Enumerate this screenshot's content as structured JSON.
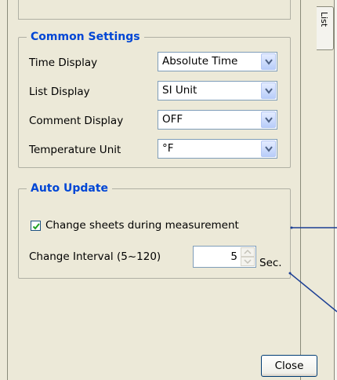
{
  "side_tab": {
    "label": "List"
  },
  "common_settings": {
    "title": "Common Settings",
    "rows": [
      {
        "label": "Time Display",
        "value": "Absolute Time"
      },
      {
        "label": "List Display",
        "value": "SI Unit"
      },
      {
        "label": "Comment Display",
        "value": "OFF"
      },
      {
        "label": "Temperature Unit",
        "value": "°F"
      }
    ]
  },
  "auto_update": {
    "title": "Auto Update",
    "change_sheets_label": "Change sheets during measurement",
    "change_sheets_checked": true,
    "interval_label": "Change Interval (5~120)",
    "interval_value": "5",
    "interval_unit": "Sec."
  },
  "footer": {
    "close_label": "Close"
  },
  "colors": {
    "group_title": "#0046d5",
    "callout_line": "#1c3f94",
    "window_bg": "#ece9d8"
  }
}
